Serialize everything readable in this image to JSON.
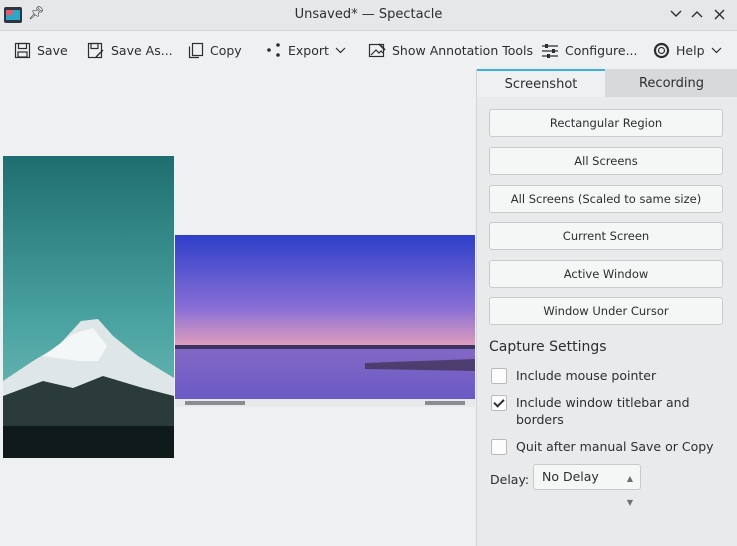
{
  "window": {
    "title": "Unsaved* — Spectacle"
  },
  "toolbar": {
    "save": "Save",
    "save_as": "Save As...",
    "copy": "Copy",
    "export": "Export",
    "annotate": "Show Annotation Tools",
    "configure": "Configure...",
    "help": "Help"
  },
  "tabs": {
    "screenshot": "Screenshot",
    "recording": "Recording"
  },
  "modes": [
    "Rectangular Region",
    "All Screens",
    "All Screens (Scaled to same size)",
    "Current Screen",
    "Active Window",
    "Window Under Cursor"
  ],
  "settings": {
    "title": "Capture Settings",
    "mouse_pointer": {
      "label": "Include mouse pointer",
      "checked": false
    },
    "titlebar": {
      "label": "Include window titlebar and borders",
      "checked": true
    },
    "quit": {
      "label": "Quit after manual Save or Copy",
      "checked": false
    },
    "delay_label": "Delay:",
    "delay_value": "No Delay"
  },
  "colors": {
    "accent": "#3daee9",
    "window_bg": "#eff0f1",
    "panel_bg": "#e9eaeb"
  }
}
